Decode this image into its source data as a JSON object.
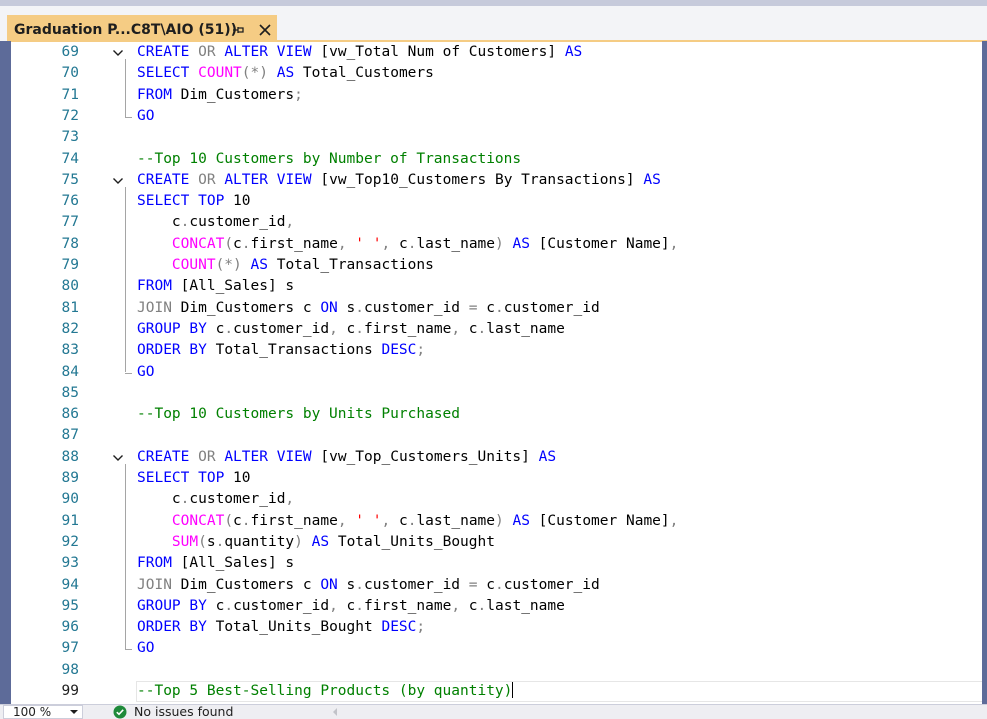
{
  "tab": {
    "title": "Graduation P...C8T\\AIO (51))",
    "pin_icon": "pin-icon",
    "close_icon": "close-icon"
  },
  "editor": {
    "current_line": "99",
    "lines": [
      {
        "n": "69",
        "fold": true,
        "t": [
          [
            "k",
            "CREATE"
          ],
          [
            "p",
            " "
          ],
          [
            "g",
            "OR"
          ],
          [
            "p",
            " "
          ],
          [
            "k",
            "ALTER"
          ],
          [
            "p",
            " "
          ],
          [
            "k",
            "VIEW"
          ],
          [
            "p",
            " [vw_Total Num of Customers] "
          ],
          [
            "k",
            "AS"
          ]
        ]
      },
      {
        "n": "70",
        "t": [
          [
            "k",
            "SELECT"
          ],
          [
            "p",
            " "
          ],
          [
            "f",
            "COUNT"
          ],
          [
            "g",
            "(*)"
          ],
          [
            "p",
            " "
          ],
          [
            "k",
            "AS"
          ],
          [
            "p",
            " Total_Customers"
          ]
        ]
      },
      {
        "n": "71",
        "t": [
          [
            "k",
            "FROM"
          ],
          [
            "p",
            " Dim_Customers"
          ],
          [
            "g",
            ";"
          ]
        ]
      },
      {
        "n": "72",
        "t": [
          [
            "k",
            "GO"
          ]
        ]
      },
      {
        "n": "73",
        "t": []
      },
      {
        "n": "74",
        "t": [
          [
            "c",
            "--Top 10 Customers by Number of Transactions"
          ]
        ]
      },
      {
        "n": "75",
        "fold": true,
        "t": [
          [
            "k",
            "CREATE"
          ],
          [
            "p",
            " "
          ],
          [
            "g",
            "OR"
          ],
          [
            "p",
            " "
          ],
          [
            "k",
            "ALTER"
          ],
          [
            "p",
            " "
          ],
          [
            "k",
            "VIEW"
          ],
          [
            "p",
            " [vw_Top10_Customers By Transactions] "
          ],
          [
            "k",
            "AS"
          ]
        ]
      },
      {
        "n": "76",
        "t": [
          [
            "k",
            "SELECT"
          ],
          [
            "p",
            " "
          ],
          [
            "k",
            "TOP"
          ],
          [
            "p",
            " 10"
          ]
        ]
      },
      {
        "n": "77",
        "t": [
          [
            "p",
            "    c"
          ],
          [
            "g",
            "."
          ],
          [
            "p",
            "customer_id"
          ],
          [
            "g",
            ","
          ]
        ]
      },
      {
        "n": "78",
        "t": [
          [
            "p",
            "    "
          ],
          [
            "f",
            "CONCAT"
          ],
          [
            "g",
            "("
          ],
          [
            "p",
            "c"
          ],
          [
            "g",
            "."
          ],
          [
            "p",
            "first_name"
          ],
          [
            "g",
            ","
          ],
          [
            "p",
            " "
          ],
          [
            "s",
            "' '"
          ],
          [
            "g",
            ","
          ],
          [
            "p",
            " c"
          ],
          [
            "g",
            "."
          ],
          [
            "p",
            "last_name"
          ],
          [
            "g",
            ")"
          ],
          [
            "p",
            " "
          ],
          [
            "k",
            "AS"
          ],
          [
            "p",
            " [Customer Name]"
          ],
          [
            "g",
            ","
          ]
        ]
      },
      {
        "n": "79",
        "t": [
          [
            "p",
            "    "
          ],
          [
            "f",
            "COUNT"
          ],
          [
            "g",
            "(*)"
          ],
          [
            "p",
            " "
          ],
          [
            "k",
            "AS"
          ],
          [
            "p",
            " Total_Transactions"
          ]
        ]
      },
      {
        "n": "80",
        "t": [
          [
            "k",
            "FROM"
          ],
          [
            "p",
            " [All_Sales] s"
          ]
        ]
      },
      {
        "n": "81",
        "t": [
          [
            "g",
            "JOIN"
          ],
          [
            "p",
            " Dim_Customers c "
          ],
          [
            "k",
            "ON"
          ],
          [
            "p",
            " s"
          ],
          [
            "g",
            "."
          ],
          [
            "p",
            "customer_id "
          ],
          [
            "g",
            "="
          ],
          [
            "p",
            " c"
          ],
          [
            "g",
            "."
          ],
          [
            "p",
            "customer_id"
          ]
        ]
      },
      {
        "n": "82",
        "t": [
          [
            "k",
            "GROUP"
          ],
          [
            "p",
            " "
          ],
          [
            "k",
            "BY"
          ],
          [
            "p",
            " c"
          ],
          [
            "g",
            "."
          ],
          [
            "p",
            "customer_id"
          ],
          [
            "g",
            ","
          ],
          [
            "p",
            " c"
          ],
          [
            "g",
            "."
          ],
          [
            "p",
            "first_name"
          ],
          [
            "g",
            ","
          ],
          [
            "p",
            " c"
          ],
          [
            "g",
            "."
          ],
          [
            "p",
            "last_name"
          ]
        ]
      },
      {
        "n": "83",
        "t": [
          [
            "k",
            "ORDER"
          ],
          [
            "p",
            " "
          ],
          [
            "k",
            "BY"
          ],
          [
            "p",
            " Total_Transactions "
          ],
          [
            "k",
            "DESC"
          ],
          [
            "g",
            ";"
          ]
        ]
      },
      {
        "n": "84",
        "t": [
          [
            "k",
            "GO"
          ]
        ]
      },
      {
        "n": "85",
        "t": []
      },
      {
        "n": "86",
        "t": [
          [
            "c",
            "--Top 10 Customers by Units Purchased"
          ]
        ]
      },
      {
        "n": "87",
        "t": []
      },
      {
        "n": "88",
        "fold": true,
        "t": [
          [
            "k",
            "CREATE"
          ],
          [
            "p",
            " "
          ],
          [
            "g",
            "OR"
          ],
          [
            "p",
            " "
          ],
          [
            "k",
            "ALTER"
          ],
          [
            "p",
            " "
          ],
          [
            "k",
            "VIEW"
          ],
          [
            "p",
            " [vw_Top_Customers_Units] "
          ],
          [
            "k",
            "AS"
          ]
        ]
      },
      {
        "n": "89",
        "t": [
          [
            "k",
            "SELECT"
          ],
          [
            "p",
            " "
          ],
          [
            "k",
            "TOP"
          ],
          [
            "p",
            " 10"
          ]
        ]
      },
      {
        "n": "90",
        "t": [
          [
            "p",
            "    c"
          ],
          [
            "g",
            "."
          ],
          [
            "p",
            "customer_id"
          ],
          [
            "g",
            ","
          ]
        ]
      },
      {
        "n": "91",
        "t": [
          [
            "p",
            "    "
          ],
          [
            "f",
            "CONCAT"
          ],
          [
            "g",
            "("
          ],
          [
            "p",
            "c"
          ],
          [
            "g",
            "."
          ],
          [
            "p",
            "first_name"
          ],
          [
            "g",
            ","
          ],
          [
            "p",
            " "
          ],
          [
            "s",
            "' '"
          ],
          [
            "g",
            ","
          ],
          [
            "p",
            " c"
          ],
          [
            "g",
            "."
          ],
          [
            "p",
            "last_name"
          ],
          [
            "g",
            ")"
          ],
          [
            "p",
            " "
          ],
          [
            "k",
            "AS"
          ],
          [
            "p",
            " [Customer Name]"
          ],
          [
            "g",
            ","
          ]
        ]
      },
      {
        "n": "92",
        "t": [
          [
            "p",
            "    "
          ],
          [
            "f",
            "SUM"
          ],
          [
            "g",
            "("
          ],
          [
            "p",
            "s"
          ],
          [
            "g",
            "."
          ],
          [
            "p",
            "quantity"
          ],
          [
            "g",
            ")"
          ],
          [
            "p",
            " "
          ],
          [
            "k",
            "AS"
          ],
          [
            "p",
            " Total_Units_Bought"
          ]
        ]
      },
      {
        "n": "93",
        "t": [
          [
            "k",
            "FROM"
          ],
          [
            "p",
            " [All_Sales] s"
          ]
        ]
      },
      {
        "n": "94",
        "t": [
          [
            "g",
            "JOIN"
          ],
          [
            "p",
            " Dim_Customers c "
          ],
          [
            "k",
            "ON"
          ],
          [
            "p",
            " s"
          ],
          [
            "g",
            "."
          ],
          [
            "p",
            "customer_id "
          ],
          [
            "g",
            "="
          ],
          [
            "p",
            " c"
          ],
          [
            "g",
            "."
          ],
          [
            "p",
            "customer_id"
          ]
        ]
      },
      {
        "n": "95",
        "t": [
          [
            "k",
            "GROUP"
          ],
          [
            "p",
            " "
          ],
          [
            "k",
            "BY"
          ],
          [
            "p",
            " c"
          ],
          [
            "g",
            "."
          ],
          [
            "p",
            "customer_id"
          ],
          [
            "g",
            ","
          ],
          [
            "p",
            " c"
          ],
          [
            "g",
            "."
          ],
          [
            "p",
            "first_name"
          ],
          [
            "g",
            ","
          ],
          [
            "p",
            " c"
          ],
          [
            "g",
            "."
          ],
          [
            "p",
            "last_name"
          ]
        ]
      },
      {
        "n": "96",
        "t": [
          [
            "k",
            "ORDER"
          ],
          [
            "p",
            " "
          ],
          [
            "k",
            "BY"
          ],
          [
            "p",
            " Total_Units_Bought "
          ],
          [
            "k",
            "DESC"
          ],
          [
            "g",
            ";"
          ]
        ]
      },
      {
        "n": "97",
        "t": [
          [
            "k",
            "GO"
          ]
        ]
      },
      {
        "n": "98",
        "t": []
      },
      {
        "n": "99",
        "t": [
          [
            "c",
            "--Top 5 Best-Selling Products (by quantity)"
          ]
        ],
        "caret": true
      }
    ]
  },
  "status": {
    "zoom": "100 %",
    "issues": "No issues found",
    "ok_icon": "check-circle-icon"
  },
  "colors": {
    "tab_active": "#f5cc84",
    "rail": "#5d6b99",
    "keyword": "#0000ff",
    "function": "#ff00ff",
    "comment": "#008000",
    "string": "#ff0000",
    "gray": "#808080",
    "line_number": "#237893"
  }
}
